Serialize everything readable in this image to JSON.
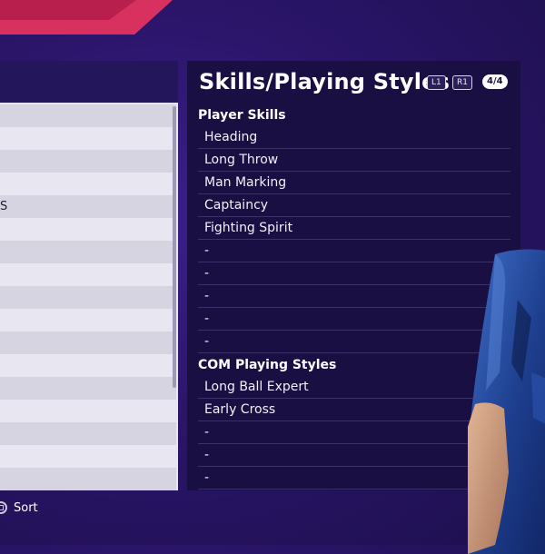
{
  "left_panel": {
    "rows": [
      "",
      "",
      "",
      "",
      "S",
      "",
      "",
      "",
      "",
      "",
      "",
      "",
      "",
      "",
      "",
      "",
      ""
    ]
  },
  "sort_hint": {
    "label": "Sort"
  },
  "skills_panel": {
    "title": "Skills/Playing Styles",
    "btn_l1": "L1",
    "btn_r1": "R1",
    "page": "4/4",
    "player_skills": {
      "heading": "Player Skills",
      "items": [
        "Heading",
        "Long Throw",
        "Man Marking",
        "Captaincy",
        "Fighting Spirit",
        "-",
        "-",
        "-",
        "-",
        "-"
      ]
    },
    "com_styles": {
      "heading": "COM Playing Styles",
      "items": [
        "Long Ball Expert",
        "Early Cross",
        "-",
        "-",
        "-"
      ]
    }
  },
  "colors": {
    "background": "#2a1569",
    "accent": "#d8305f",
    "panel": "#1a0f43",
    "list_panel": "#e7e6ee"
  }
}
